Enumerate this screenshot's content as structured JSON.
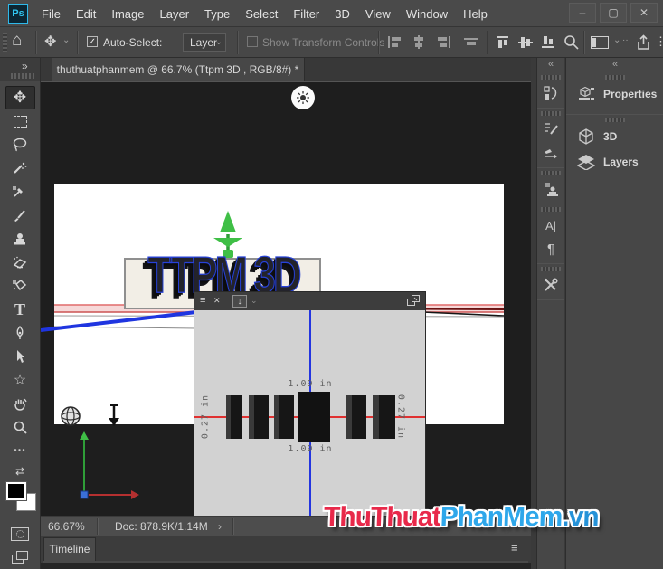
{
  "titlebar": {
    "logo": "Ps",
    "menu": [
      "File",
      "Edit",
      "Image",
      "Layer",
      "Type",
      "Select",
      "Filter",
      "3D",
      "View",
      "Window",
      "Help"
    ],
    "minimize": "–",
    "maximize": "▢",
    "close": "✕"
  },
  "options_bar": {
    "auto_select_label": "Auto-Select:",
    "auto_select_checked": "✓",
    "layer_picker_value": "Layer",
    "show_transform_label": "Show Transform Controls"
  },
  "tabbar": {
    "doc_tab": "thuthuatphanmem @ 66.7% (Ttpm 3D , RGB/8#) *",
    "close": "✕"
  },
  "toolbar": {
    "collapse": "»",
    "tools": [
      "move",
      "rectangular-marquee",
      "lasso",
      "quick-selection",
      "eyedropper",
      "brush",
      "clone-stamp",
      "eraser",
      "paint-bucket",
      "type",
      "pen",
      "path-selection",
      "custom-shape",
      "hand",
      "zoom",
      "edit-toolbar",
      "swap-colors",
      "foreground-background-swatches",
      "quick-mask",
      "screen-mode"
    ]
  },
  "canvas": {
    "text_3d": "TTPM 3D"
  },
  "secondary_view": {
    "measure_top": "1.09 in",
    "measure_bottom": "1.09 in",
    "measure_left": "0.27 in",
    "measure_right": "0.27 in"
  },
  "dock": {
    "collapse": "«",
    "panel_tabs": [
      "Properties",
      "3D",
      "Layers"
    ]
  },
  "status_bar": {
    "zoom_level": "66.67%",
    "doc_size": "Doc: 878.9K/1.14M",
    "chevron": "›"
  },
  "timeline": {
    "tab_label": "Timeline",
    "menu_icon": "≡"
  },
  "watermark": {
    "part1": "ThuThuat",
    "part2": "PhanMem",
    "part3": ".vn",
    "red": "#e8294a",
    "blue": "#2ea7ea"
  },
  "icons": {
    "home": "⌂",
    "move": "✥",
    "chevron_down": "⌄",
    "type": "T",
    "shape": "☆",
    "ellipsis": "•••",
    "swap": "⇄",
    "kebab": "⋮",
    "dots2": "··",
    "grip_menu": "≡",
    "close_small": "✕",
    "down_arrow": "↓",
    "character": "A|",
    "paragraph": "¶"
  }
}
